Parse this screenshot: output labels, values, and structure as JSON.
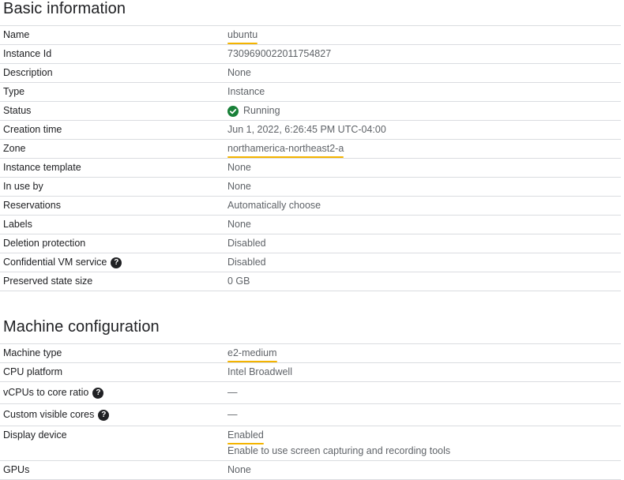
{
  "basic": {
    "title": "Basic information",
    "rows": [
      {
        "label": "Name",
        "value": "ubuntu"
      },
      {
        "label": "Instance Id",
        "value": "7309690022011754827"
      },
      {
        "label": "Description",
        "value": "None"
      },
      {
        "label": "Type",
        "value": "Instance"
      },
      {
        "label": "Status",
        "value": "Running",
        "icon": "check-circle-icon",
        "icon_color": "#188038"
      },
      {
        "label": "Creation time",
        "value": "Jun 1, 2022, 6:26:45 PM UTC-04:00"
      },
      {
        "label": "Zone",
        "value": "northamerica-northeast2-a"
      },
      {
        "label": "Instance template",
        "value": "None"
      },
      {
        "label": "In use by",
        "value": "None"
      },
      {
        "label": "Reservations",
        "value": "Automatically choose"
      },
      {
        "label": "Labels",
        "value": "None"
      },
      {
        "label": "Deletion protection",
        "value": "Disabled"
      },
      {
        "label": "Confidential VM service",
        "value": "Disabled",
        "icon": "help-icon"
      },
      {
        "label": "Preserved state size",
        "value": "0 GB"
      }
    ]
  },
  "machine": {
    "title": "Machine configuration",
    "rows": [
      {
        "label": "Machine type",
        "value": "e2-medium"
      },
      {
        "label": "CPU platform",
        "value": "Intel Broadwell"
      },
      {
        "label": "vCPUs to core ratio",
        "value": "—",
        "icon": "help-icon"
      },
      {
        "label": "Custom visible cores",
        "value": "—",
        "icon": "help-icon"
      },
      {
        "label": "Display device",
        "value": "Enabled",
        "subtext": "Enable to use screen capturing and recording tools"
      },
      {
        "label": "GPUs",
        "value": "None"
      }
    ]
  },
  "icons": {
    "help_glyph": "?"
  },
  "colors": {
    "highlight": "#f4b400",
    "status_ok": "#188038",
    "divider": "#dadce0"
  }
}
